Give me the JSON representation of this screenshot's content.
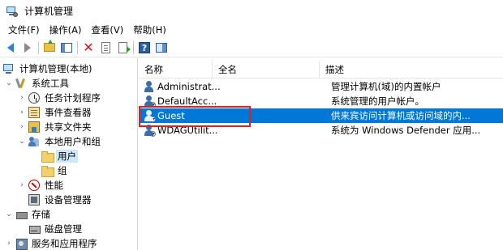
{
  "window": {
    "title": "计算机管理",
    "icon": "computer-management-icon"
  },
  "menu": {
    "items": [
      "文件(F)",
      "操作(A)",
      "查看(V)",
      "帮助(H)"
    ]
  },
  "toolbar": {
    "icons": [
      "back-arrow-icon",
      "forward-arrow-icon",
      "up-folder-icon",
      "show-tree-icon",
      "delete-icon",
      "properties-icon",
      "export-icon",
      "help-icon",
      "action-pane-icon"
    ]
  },
  "tree": {
    "root": "计算机管理(本地)",
    "system_tools": "系统工具",
    "task_scheduler": "任务计划程序",
    "event_viewer": "事件查看器",
    "shared_folders": "共享文件夹",
    "local_users_groups": "本地用户和组",
    "users": "用户",
    "groups": "组",
    "performance": "性能",
    "device_manager": "设备管理器",
    "storage": "存储",
    "disk_management": "磁盘管理",
    "services_apps": "服务和应用程序"
  },
  "list": {
    "columns": [
      "名称",
      "全名",
      "描述"
    ],
    "rows": [
      {
        "name": "Administrat...",
        "full_name": "",
        "description": "管理计算机(域)的内置帐户"
      },
      {
        "name": "DefaultAcc...",
        "full_name": "",
        "description": "系统管理的用户帐户。"
      },
      {
        "name": "Guest",
        "full_name": "",
        "description": "供来宾访问计算机或访问域的内..."
      },
      {
        "name": "WDAGUtilit...",
        "full_name": "",
        "description": "系统为 Windows Defender 应用..."
      }
    ],
    "selected_row": 2
  },
  "colors": {
    "selection": "#0078d7",
    "tree_selection": "#cce8ff",
    "highlight_box": "#e02020"
  }
}
